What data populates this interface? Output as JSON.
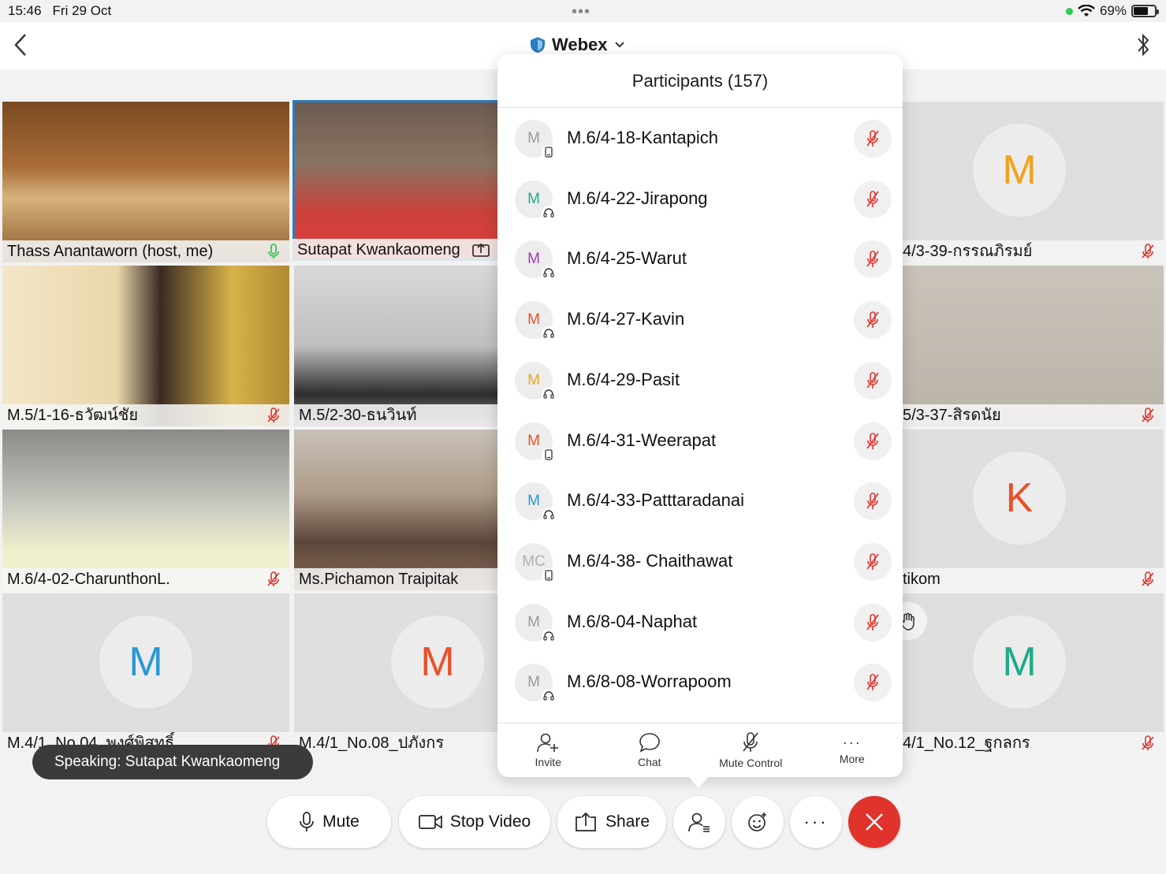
{
  "status_bar": {
    "time": "15:46",
    "date": "Fri 29 Oct",
    "battery": "69%",
    "battery_level": 0.69
  },
  "header": {
    "title": "Webex"
  },
  "tiles": [
    {
      "name": "Thass Anantaworn (host, me)",
      "mic": "on"
    },
    {
      "name": "Sutapat Kwankaomeng",
      "mic": "sharing"
    },
    {
      "name": "4/3-39-กรรณภิรมย์",
      "mic": "muted",
      "avatar": "M",
      "avatar_color": "#f0a21c"
    },
    {
      "name": "M.5/1-16-ธวัฒน์ชัย",
      "mic": "muted"
    },
    {
      "name": "M.5/2-30-ธนวินท์",
      "mic": "none"
    },
    {
      "name": "5/3-37-สิรดนัย",
      "mic": "muted"
    },
    {
      "name": "M.6/4-02-CharunthonL.",
      "mic": "muted"
    },
    {
      "name": "Ms.Pichamon Traipitak",
      "mic": "none"
    },
    {
      "name": "tikom",
      "mic": "muted",
      "avatar": "K",
      "avatar_color": "#e8512a"
    },
    {
      "name": "M.4/1_No.04_พงศ์พิสุทธิ์",
      "mic": "muted",
      "avatar": "M",
      "avatar_color": "#2a97d4"
    },
    {
      "name": "M.4/1_No.08_ปภังกร",
      "mic": "none",
      "avatar": "M",
      "avatar_color": "#e8512a"
    },
    {
      "name": "4/1_No.12_ฐกลกร",
      "mic": "muted",
      "avatar": "M",
      "avatar_color": "#1fa98a"
    }
  ],
  "toast": {
    "text": "Speaking: Sutapat Kwankaomeng"
  },
  "controls": {
    "mute": "Mute",
    "stop_video": "Stop Video",
    "share": "Share"
  },
  "participants": {
    "title": "Participants (157)",
    "items": [
      {
        "initials": "M",
        "color": "#9a9a9a",
        "device": "phone",
        "name": "M.6/4-18-Kantapich"
      },
      {
        "initials": "M",
        "color": "#1fa98a",
        "device": "headset",
        "name": "M.6/4-22-Jirapong"
      },
      {
        "initials": "M",
        "color": "#a23bb0",
        "device": "headset",
        "name": "M.6/4-25-Warut"
      },
      {
        "initials": "M",
        "color": "#e8512a",
        "device": "headset",
        "name": "M.6/4-27-Kavin"
      },
      {
        "initials": "M",
        "color": "#f0a21c",
        "device": "headset",
        "name": "M.6/4-29-Pasit"
      },
      {
        "initials": "M",
        "color": "#e8512a",
        "device": "phone",
        "name": "M.6/4-31-Weerapat"
      },
      {
        "initials": "M",
        "color": "#2a97d4",
        "device": "headset",
        "name": "M.6/4-33-Patttaradanai"
      },
      {
        "initials": "MC",
        "color": "#b0b0b0",
        "device": "phone",
        "name": "M.6/4-38- Chaithawat"
      },
      {
        "initials": "M",
        "color": "#9a9a9a",
        "device": "headset",
        "name": "M.6/8-04-Naphat"
      },
      {
        "initials": "M",
        "color": "#9a9a9a",
        "device": "headset",
        "name": "M.6/8-08-Worrapoom"
      }
    ],
    "toolbar": {
      "invite": "Invite",
      "chat": "Chat",
      "mute_control": "Mute Control",
      "more": "More"
    }
  },
  "colors": {
    "mute_red": "#e0332b",
    "accent_blue": "#2a7dbf",
    "mic_green": "#34c759"
  }
}
